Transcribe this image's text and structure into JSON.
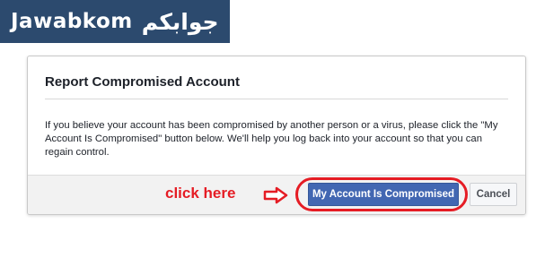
{
  "logo": {
    "latin_text": "Jawabkom",
    "arabic_text": "جوابكم"
  },
  "dialog": {
    "title": "Report Compromised Account",
    "body": "If you believe your account has been compromised by another person or a virus, please click the \"My Account Is Compromised\" button below. We'll help you log back into your account so that you can regain control.",
    "primary_button_label": "My Account Is Compromised",
    "cancel_button_label": "Cancel"
  },
  "annotation": {
    "label": "click here",
    "color": "#e51c24"
  },
  "colors": {
    "logo_background": "#2c4a6e",
    "primary_button": "#4267b2",
    "footer_background": "#f2f2f2"
  }
}
